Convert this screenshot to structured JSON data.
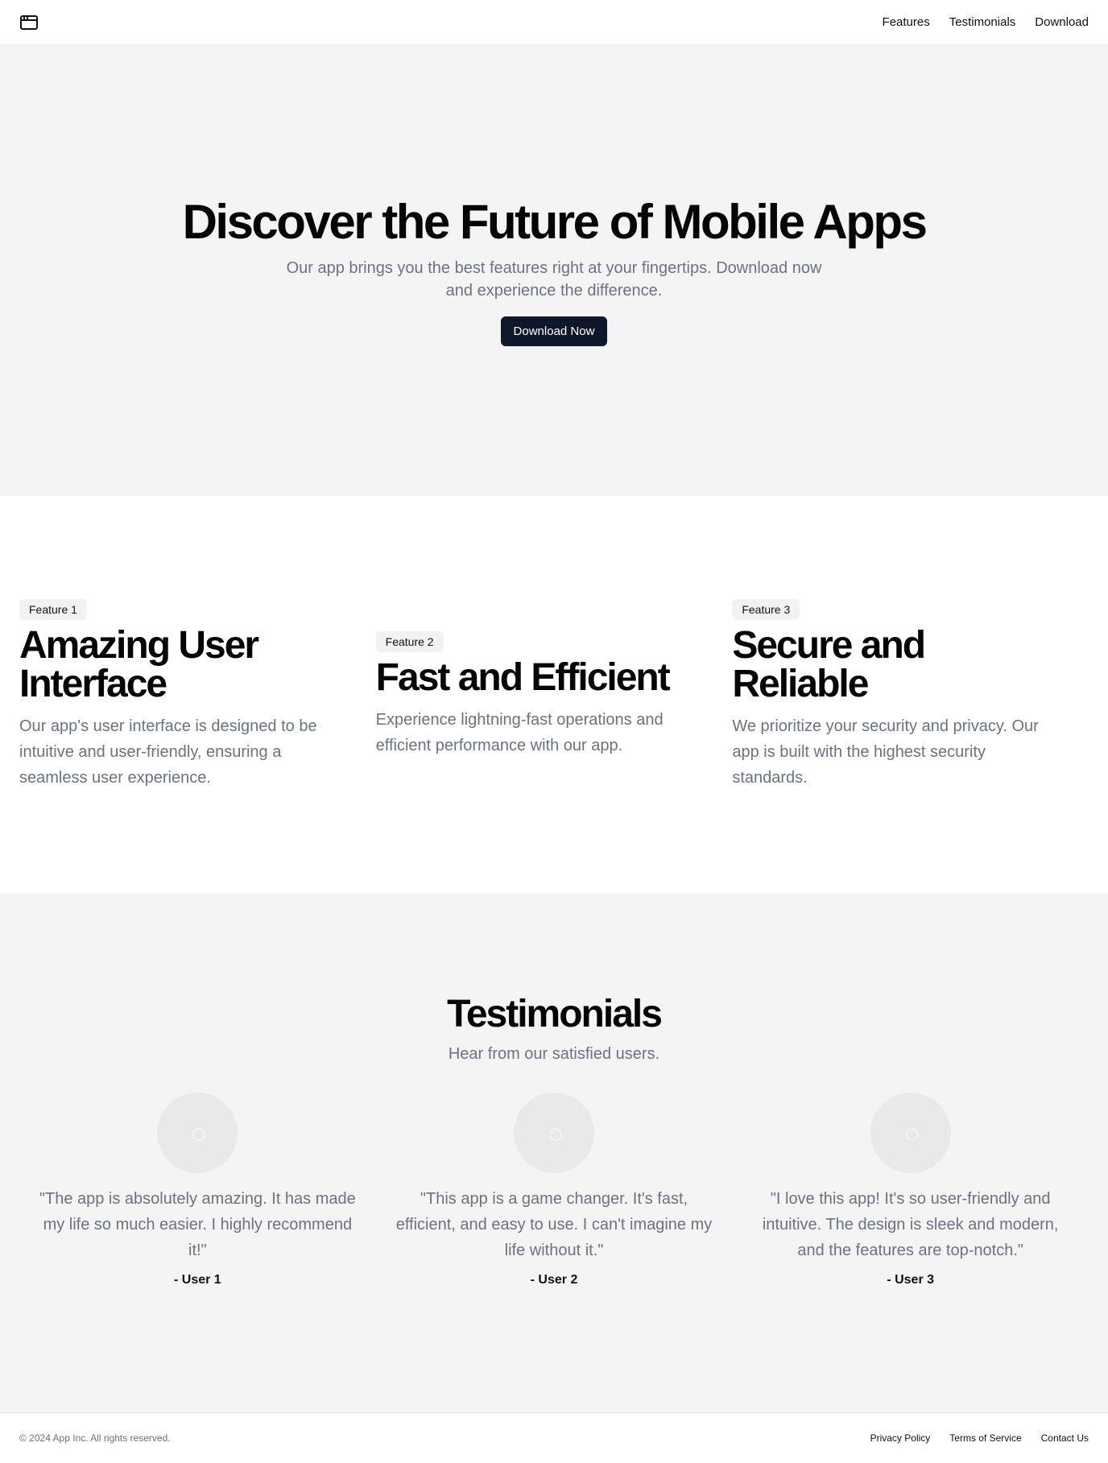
{
  "header": {
    "logo_icon": "browser-window-icon",
    "nav": [
      {
        "label": "Features"
      },
      {
        "label": "Testimonials"
      },
      {
        "label": "Download"
      }
    ]
  },
  "hero": {
    "title": "Discover the Future of Mobile Apps",
    "subtitle": "Our app brings you the best features right at your fingertips. Download now and experience the difference.",
    "cta_label": "Download Now"
  },
  "features": [
    {
      "badge": "Feature 1",
      "title": "Amazing User Interface",
      "description": "Our app's user interface is designed to be intuitive and user-friendly, ensuring a seamless user experience."
    },
    {
      "badge": "Feature 2",
      "title": "Fast and Efficient",
      "description": "Experience lightning-fast operations and efficient performance with our app."
    },
    {
      "badge": "Feature 3",
      "title": "Secure and Reliable",
      "description": "We prioritize your security and privacy. Our app is built with the highest security standards."
    }
  ],
  "testimonials": {
    "title": "Testimonials",
    "subtitle": "Hear from our satisfied users.",
    "items": [
      {
        "quote": "\"The app is absolutely amazing. It has made my life so much easier. I highly recommend it!\"",
        "author": "- User 1"
      },
      {
        "quote": "\"This app is a game changer. It's fast, efficient, and easy to use. I can't imagine my life without it.\"",
        "author": "- User 2"
      },
      {
        "quote": "\"I love this app! It's so user-friendly and intuitive. The design is sleek and modern, and the features are top-notch.\"",
        "author": "- User 3"
      }
    ]
  },
  "footer": {
    "copyright": "© 2024 App Inc. All rights reserved.",
    "links": [
      {
        "label": "Privacy Policy"
      },
      {
        "label": "Terms of Service"
      },
      {
        "label": "Contact Us"
      }
    ]
  },
  "colors": {
    "primary_button": "#0f172a",
    "section_gray": "#f4f4f5",
    "muted_text": "#6b7280"
  }
}
